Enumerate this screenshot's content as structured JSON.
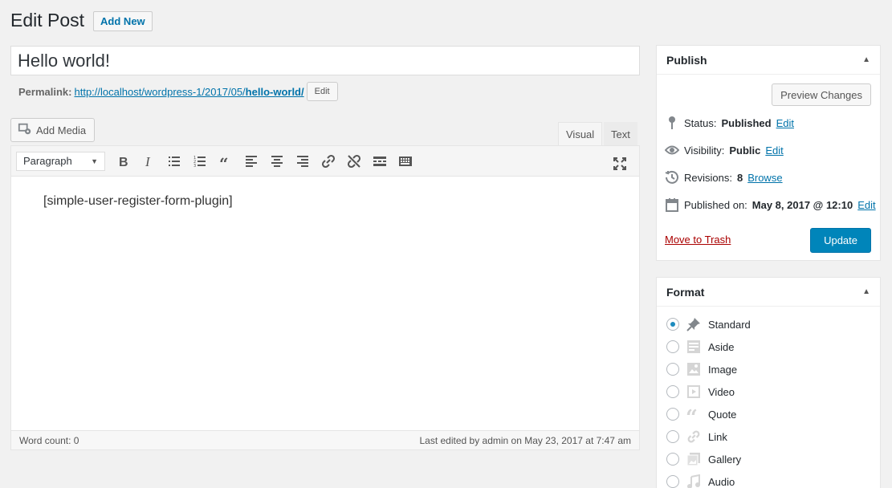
{
  "header": {
    "title": "Edit Post",
    "add_new": "Add New"
  },
  "post": {
    "title": "Hello world!"
  },
  "permalink": {
    "label": "Permalink:",
    "url_base": "http://localhost/wordpress-1/2017/05/",
    "url_slug": "hello-world/",
    "edit_label": "Edit"
  },
  "editor": {
    "add_media": "Add Media",
    "tab_visual": "Visual",
    "tab_text": "Text",
    "format_selected": "Paragraph",
    "content": "[simple-user-register-form-plugin]",
    "word_count": "Word count: 0",
    "last_edited": "Last edited by admin on May 23, 2017 at 7:47 am",
    "toolbar_icons": [
      "bold-icon",
      "italic-icon",
      "bullet-list-icon",
      "numbered-list-icon",
      "blockquote-icon",
      "align-left-icon",
      "align-center-icon",
      "align-right-icon",
      "link-icon",
      "unlink-icon",
      "read-more-icon",
      "toolbar-toggle-icon",
      "fullscreen-icon"
    ]
  },
  "publish": {
    "title": "Publish",
    "preview": "Preview Changes",
    "status_label": "Status:",
    "status_value": "Published",
    "visibility_label": "Visibility:",
    "visibility_value": "Public",
    "revisions_label": "Revisions:",
    "revisions_value": "8",
    "browse": "Browse",
    "published_label": "Published on:",
    "published_value": "May 8, 2017 @ 12:10",
    "edit": "Edit",
    "trash": "Move to Trash",
    "update": "Update"
  },
  "format": {
    "title": "Format",
    "options": [
      "Standard",
      "Aside",
      "Image",
      "Video",
      "Quote",
      "Link",
      "Gallery",
      "Audio"
    ],
    "selected_index": 0
  },
  "colors": {
    "accent": "#0073aa",
    "primary_button": "#0085ba",
    "trash": "#aa0000"
  }
}
